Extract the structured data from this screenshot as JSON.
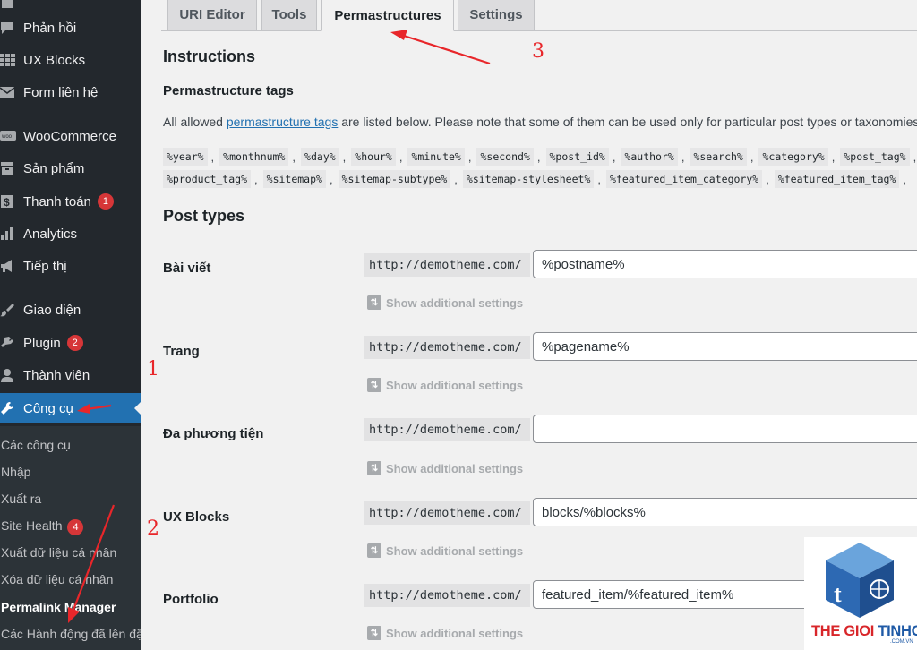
{
  "sidebar": {
    "items": [
      {
        "label": "Phản hồi",
        "icon": "comment-icon"
      },
      {
        "label": "UX Blocks",
        "icon": "grid-icon"
      },
      {
        "label": "Form liên hệ",
        "icon": "mail-icon"
      },
      {
        "label": "WooCommerce",
        "icon": "woo-icon"
      },
      {
        "label": "Sản phẩm",
        "icon": "archive-icon"
      },
      {
        "label": "Thanh toán",
        "icon": "dollar-icon",
        "badge": "1"
      },
      {
        "label": "Analytics",
        "icon": "bar-chart-icon"
      },
      {
        "label": "Tiếp thị",
        "icon": "megaphone-icon"
      },
      {
        "label": "Giao diện",
        "icon": "brush-icon"
      },
      {
        "label": "Plugin",
        "icon": "plug-icon",
        "badge": "2"
      },
      {
        "label": "Thành viên",
        "icon": "user-icon"
      },
      {
        "label": "Công cụ",
        "icon": "wrench-icon",
        "active": true
      }
    ],
    "submenu": [
      {
        "label": "Các công cụ"
      },
      {
        "label": "Nhập"
      },
      {
        "label": "Xuất ra"
      },
      {
        "label": "Site Health",
        "badge": "4"
      },
      {
        "label": "Xuất dữ liệu cá nhân"
      },
      {
        "label": "Xóa dữ liệu cá nhân"
      },
      {
        "label": "Permalink Manager",
        "current": true
      },
      {
        "label": "Các Hành động đã lên đặt"
      }
    ]
  },
  "tabs": [
    {
      "label": "URI Editor"
    },
    {
      "label": "Tools"
    },
    {
      "label": "Permastructures",
      "active": true
    },
    {
      "label": "Settings"
    }
  ],
  "instructions": {
    "title": "Instructions",
    "subtitle": "Permastructure tags",
    "desc_prefix": "All allowed ",
    "desc_link": "permastructure tags",
    "desc_suffix": " are listed below. Please note that some of them can be used only for particular post types or taxonomies."
  },
  "tags_row1": [
    "%year%",
    "%monthnum%",
    "%day%",
    "%hour%",
    "%minute%",
    "%second%",
    "%post_id%",
    "%author%",
    "%search%",
    "%category%",
    "%post_tag%"
  ],
  "tags_row2": [
    "%product_tag%",
    "%sitemap%",
    "%sitemap-subtype%",
    "%sitemap-stylesheet%",
    "%featured_item_category%",
    "%featured_item_tag%"
  ],
  "post_types": {
    "title": "Post types",
    "show_additional": "Show additional settings",
    "prefix": "http://demotheme.com/",
    "items": [
      {
        "label": "Bài viết",
        "value": "%postname%"
      },
      {
        "label": "Trang",
        "value": "%pagename%"
      },
      {
        "label": "Đa phương tiện",
        "value": ""
      },
      {
        "label": "UX Blocks",
        "value": "blocks/%blocks%"
      },
      {
        "label": "Portfolio",
        "value": "featured_item/%featured_item%"
      }
    ]
  },
  "annotations": [
    "1",
    "2",
    "3"
  ],
  "watermark": {
    "part1": "THE GIOI",
    "part2": "TINHOC",
    "small": ".COM.VN"
  },
  "colors": {
    "accent": "#2271b1",
    "sidebar": "#23282d",
    "annotation": "#e8262a",
    "badge": "#d63638"
  }
}
